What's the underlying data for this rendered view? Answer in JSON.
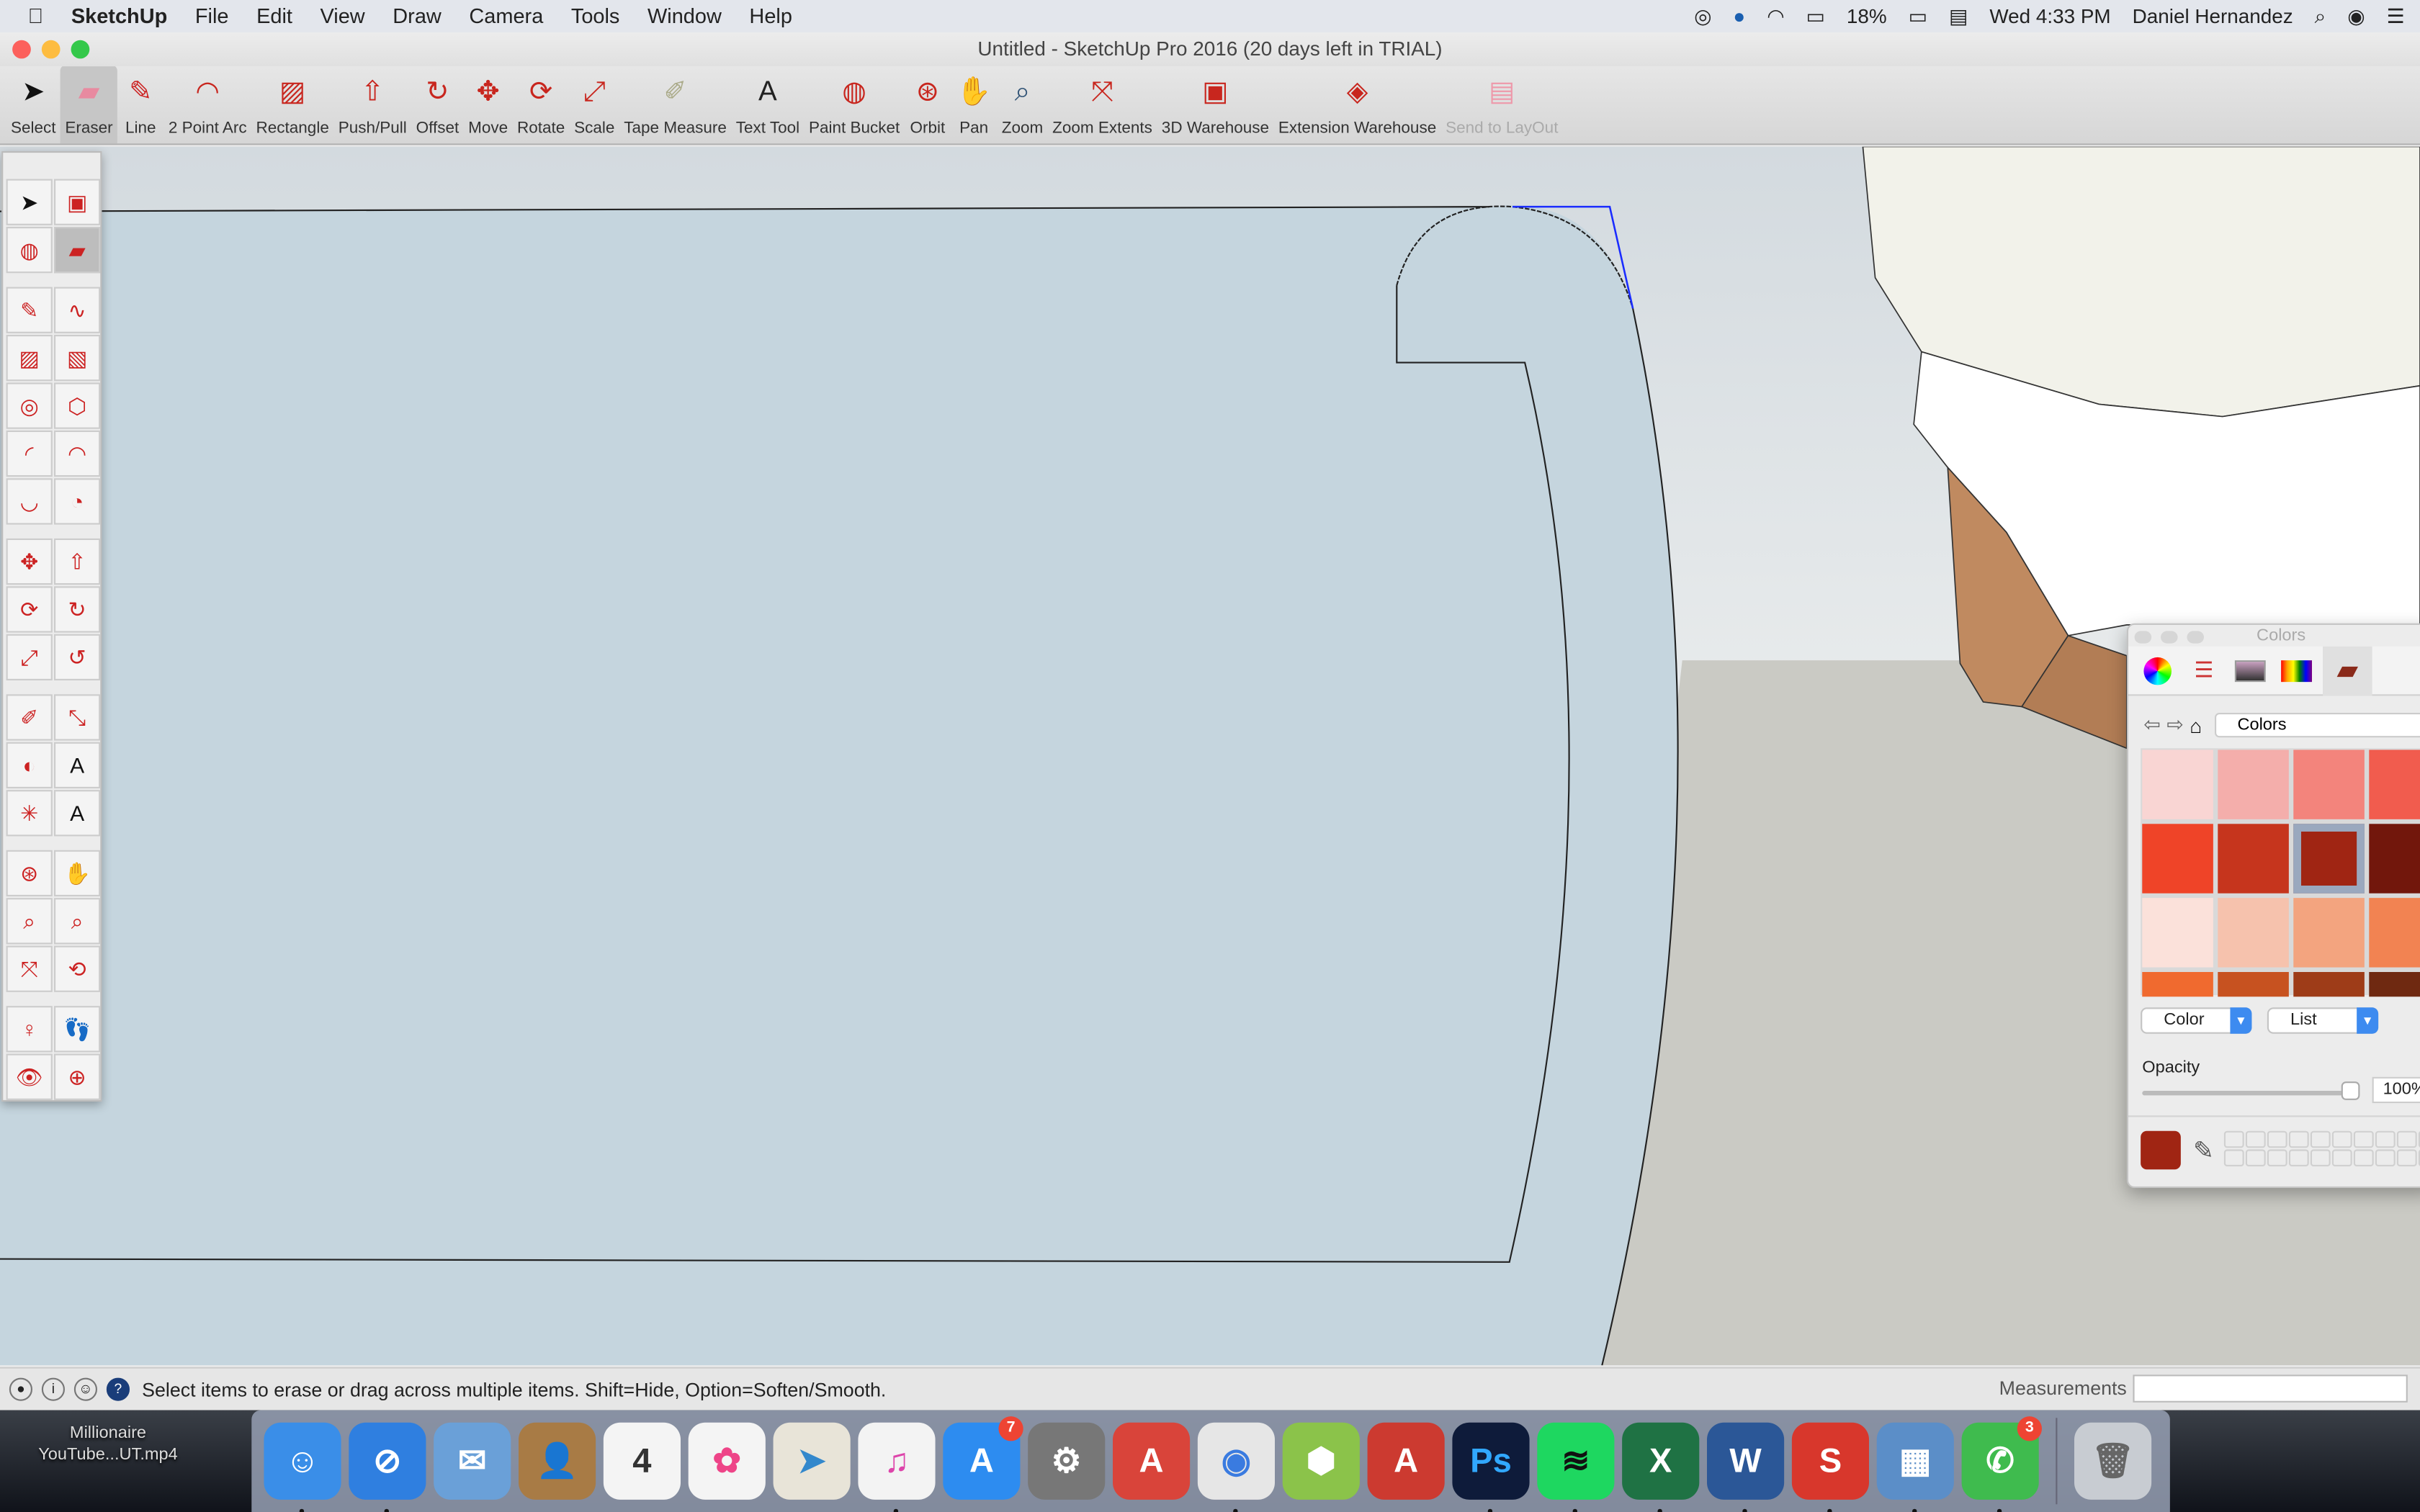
{
  "menubar": {
    "app": "SketchUp",
    "items": [
      "File",
      "Edit",
      "View",
      "Draw",
      "Camera",
      "Tools",
      "Window",
      "Help"
    ],
    "battery": "18%",
    "clock": "Wed 4:33 PM",
    "user": "Daniel Hernandez"
  },
  "window": {
    "title": "Untitled - SketchUp Pro 2016 (20 days left in TRIAL)"
  },
  "toolbar": [
    {
      "label": "Select",
      "icon": "arrow-icon"
    },
    {
      "label": "Eraser",
      "icon": "eraser-icon",
      "active": true
    },
    {
      "label": "Line",
      "icon": "pencil-icon"
    },
    {
      "label": "2 Point Arc",
      "icon": "arc-icon"
    },
    {
      "label": "Rectangle",
      "icon": "rectangle-icon"
    },
    {
      "label": "Push/Pull",
      "icon": "pushpull-icon"
    },
    {
      "label": "Offset",
      "icon": "offset-icon"
    },
    {
      "label": "Move",
      "icon": "move-icon"
    },
    {
      "label": "Rotate",
      "icon": "rotate-icon"
    },
    {
      "label": "Scale",
      "icon": "scale-icon"
    },
    {
      "label": "Tape Measure",
      "icon": "tape-icon"
    },
    {
      "label": "Text Tool",
      "icon": "text-icon"
    },
    {
      "label": "Paint Bucket",
      "icon": "bucket-icon"
    },
    {
      "label": "Orbit",
      "icon": "orbit-icon"
    },
    {
      "label": "Pan",
      "icon": "hand-icon"
    },
    {
      "label": "Zoom",
      "icon": "magnifier-icon"
    },
    {
      "label": "Zoom Extents",
      "icon": "zoom-extents-icon"
    },
    {
      "label": "3D Warehouse",
      "icon": "warehouse-icon"
    },
    {
      "label": "Extension Warehouse",
      "icon": "extension-icon"
    },
    {
      "label": "Send to LayOut",
      "icon": "layout-icon",
      "disabled": true
    }
  ],
  "status": {
    "hint": "Select items to erase or drag across multiple items. Shift=Hide, Option=Soften/Smooth.",
    "measurements_label": "Measurements",
    "measurements_value": ""
  },
  "colors_panel": {
    "title": "Colors",
    "palette": "Colors",
    "mode": "Color",
    "view": "List",
    "opacity_label": "Opacity",
    "opacity": "100%",
    "opacity_value": 100,
    "current_color": "#a02513",
    "swatches": [
      "#f9d5d3",
      "#f4aeab",
      "#f3847c",
      "#f15c4e",
      "#ef4428",
      "#c6351d",
      "#a02513",
      "#72170c",
      "#fbe1da",
      "#f6c2ad",
      "#f3a47f",
      "#f28352",
      "#f06a2f",
      "#c75220",
      "#9e3c18",
      "#6f2911"
    ]
  },
  "desktop": {
    "file": "Millionaire YouTube...UT.mp4"
  },
  "dock": [
    {
      "name": "Finder",
      "color": "#3a8ee8",
      "glyph": "☺"
    },
    {
      "name": "Safari",
      "color": "#2f7fe0",
      "glyph": "⊘"
    },
    {
      "name": "Mail",
      "color": "#6aa0d8",
      "glyph": "✉"
    },
    {
      "name": "Contacts",
      "color": "#a87b45",
      "glyph": "👤"
    },
    {
      "name": "Calendar",
      "color": "#f4f4f4",
      "glyph": "4",
      "text": "#333"
    },
    {
      "name": "Photos",
      "color": "#f4f4f4",
      "glyph": "✿",
      "text": "#e48"
    },
    {
      "name": "Maps",
      "color": "#e8e4d8",
      "glyph": "➤",
      "text": "#38c"
    },
    {
      "name": "iTunes",
      "color": "#f3f3f3",
      "glyph": "♫",
      "text": "#d4a"
    },
    {
      "name": "App Store",
      "color": "#2d8cf0",
      "glyph": "A",
      "badge": "7"
    },
    {
      "name": "System Preferences",
      "color": "#777",
      "glyph": "⚙"
    },
    {
      "name": "AutoCAD",
      "color": "#d9443a",
      "glyph": "A"
    },
    {
      "name": "Chrome",
      "color": "#e6e6e6",
      "glyph": "◉",
      "text": "#3a7be0"
    },
    {
      "name": "App",
      "color": "#8bc34a",
      "glyph": "⬢"
    },
    {
      "name": "AutoCAD 2",
      "color": "#cc3a30",
      "glyph": "A"
    },
    {
      "name": "Photoshop",
      "color": "#0e1b3a",
      "glyph": "Ps",
      "text": "#31a8ff"
    },
    {
      "name": "Spotify",
      "color": "#1ed760",
      "glyph": "≋",
      "text": "#111"
    },
    {
      "name": "Excel",
      "color": "#1f7244",
      "glyph": "X"
    },
    {
      "name": "Word",
      "color": "#2b5797",
      "glyph": "W"
    },
    {
      "name": "SketchUp",
      "color": "#d8372c",
      "glyph": "S"
    },
    {
      "name": "Preview",
      "color": "#5b8ec8",
      "glyph": "▦"
    },
    {
      "name": "WhatsApp",
      "color": "#3fbb4e",
      "glyph": "✆",
      "badge": "3"
    },
    {
      "name": "Trash",
      "color": "#c8ccd2",
      "glyph": "🗑",
      "text": "#666"
    }
  ]
}
